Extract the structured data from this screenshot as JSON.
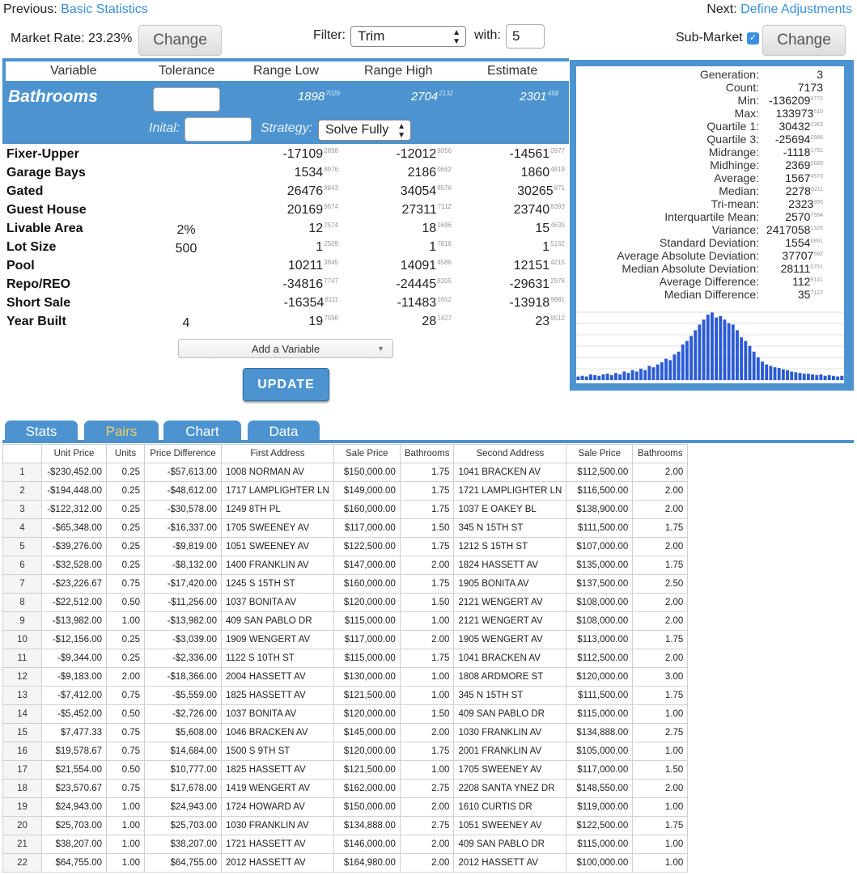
{
  "nav": {
    "previous_label": "Previous:",
    "previous_link": "Basic Statistics",
    "next_label": "Next:",
    "next_link": "Define Adjustments"
  },
  "toolbar": {
    "market_rate": "Market Rate: 23.23%",
    "change_left": "Change",
    "filter_label": "Filter:",
    "filter_value": "Trim",
    "with_label": "with:",
    "with_value": "5",
    "submarket_label": "Sub-Market",
    "submarket_checked": true,
    "change_right": "Change"
  },
  "columns": {
    "variable": "Variable",
    "tolerance": "Tolerance",
    "range_low": "Range Low",
    "range_high": "Range High",
    "estimate": "Estimate"
  },
  "selected": {
    "name": "Bathrooms",
    "low": "1898",
    "low_sup": "7029",
    "high": "2704",
    "high_sup": "2132",
    "est": "2301",
    "est_sup": "458",
    "initial_label": "Inital:",
    "strategy_label": "Strategy:",
    "strategy_value": "Solve Fully"
  },
  "variables": [
    {
      "name": "Fixer-Upper",
      "tol": "",
      "low": "-17109",
      "low_sup": "2898",
      "high": "-12012",
      "high_sup": "9056",
      "est": "-14561",
      "est_sup": "0977"
    },
    {
      "name": "Garage Bays",
      "tol": "",
      "low": "1534",
      "low_sup": "8976",
      "high": "2186",
      "high_sup": "0662",
      "est": "1860",
      "est_sup": "4819"
    },
    {
      "name": "Gated",
      "tol": "",
      "low": "26476",
      "low_sup": "8843",
      "high": "34054",
      "high_sup": "8576",
      "est": "30265",
      "est_sup": "871"
    },
    {
      "name": "Guest House",
      "tol": "",
      "low": "20169",
      "low_sup": "9674",
      "high": "27311",
      "high_sup": "7112",
      "est": "23740",
      "est_sup": "8393"
    },
    {
      "name": "Livable Area",
      "tol": "2%",
      "low": "12",
      "low_sup": "7574",
      "high": "18",
      "high_sup": "1696",
      "est": "15",
      "est_sup": "4635"
    },
    {
      "name": "Lot Size",
      "tol": "500",
      "low": "1",
      "low_sup": "2509",
      "high": "1",
      "high_sup": "7816",
      "est": "1",
      "est_sup": "5162"
    },
    {
      "name": "Pool",
      "tol": "",
      "low": "10211",
      "low_sup": "3845",
      "high": "14091",
      "high_sup": "4586",
      "est": "12151",
      "est_sup": "4215"
    },
    {
      "name": "Repo/REO",
      "tol": "",
      "low": "-34816",
      "low_sup": "7747",
      "high": "-24445",
      "high_sup": "8205",
      "est": "-29631",
      "est_sup": "2976"
    },
    {
      "name": "Short Sale",
      "tol": "",
      "low": "-16354",
      "low_sup": "8111",
      "high": "-11483",
      "high_sup": "1652",
      "est": "-13918",
      "est_sup": "9881"
    },
    {
      "name": "Year Built",
      "tol": "4",
      "low": "19",
      "low_sup": "7598",
      "high": "28",
      "high_sup": "1427",
      "est": "23",
      "est_sup": "9512"
    }
  ],
  "add_variable": "Add a Variable",
  "update_button": "UPDATE",
  "stats": [
    {
      "label": "Generation:",
      "value": "3",
      "sup": ""
    },
    {
      "label": "Count:",
      "value": "7173",
      "sup": ""
    },
    {
      "label": "Min:",
      "value": "-136209",
      "sup": "9772"
    },
    {
      "label": "Max:",
      "value": "133973",
      "sup": "519"
    },
    {
      "label": "Quartile 1:",
      "value": "30432",
      "sup": "2363"
    },
    {
      "label": "Quartile 3:",
      "value": "-25694",
      "sup": "0986"
    },
    {
      "label": "Midrange:",
      "value": "-1118",
      "sup": "1791"
    },
    {
      "label": "Midhinge:",
      "value": "2369",
      "sup": "0689"
    },
    {
      "label": "Average:",
      "value": "1567",
      "sup": "4573"
    },
    {
      "label": "Median:",
      "value": "2278",
      "sup": "8211"
    },
    {
      "label": "Tri-mean:",
      "value": "2323",
      "sup": "995"
    },
    {
      "label": "Interquartile Mean:",
      "value": "2570",
      "sup": "7564"
    },
    {
      "label": "Variance:",
      "value": "2417058",
      "sup": "1326"
    },
    {
      "label": "Standard Deviation:",
      "value": "1554",
      "sup": "6891"
    },
    {
      "label": "Average Absolute Deviation:",
      "value": "37707",
      "sup": "592"
    },
    {
      "label": "Median Absolute Deviation:",
      "value": "28111",
      "sup": "0751"
    },
    {
      "label": "Average Difference:",
      "value": "112",
      "sup": "9141"
    },
    {
      "label": "Median Difference:",
      "value": "35",
      "sup": "7122"
    }
  ],
  "histogram": [
    0.05,
    0.06,
    0.05,
    0.08,
    0.07,
    0.06,
    0.08,
    0.09,
    0.07,
    0.1,
    0.08,
    0.12,
    0.1,
    0.14,
    0.12,
    0.16,
    0.14,
    0.2,
    0.18,
    0.22,
    0.25,
    0.3,
    0.28,
    0.36,
    0.4,
    0.5,
    0.55,
    0.62,
    0.7,
    0.78,
    0.85,
    0.92,
    0.95,
    0.88,
    0.9,
    0.85,
    0.8,
    0.78,
    0.7,
    0.6,
    0.55,
    0.48,
    0.4,
    0.32,
    0.26,
    0.22,
    0.2,
    0.18,
    0.17,
    0.15,
    0.14,
    0.12,
    0.11,
    0.1,
    0.09,
    0.09,
    0.08,
    0.07,
    0.08,
    0.06,
    0.07,
    0.06,
    0.05,
    0.06
  ],
  "tabs": [
    "Stats",
    "Pairs",
    "Chart",
    "Data"
  ],
  "active_tab": 1,
  "table_headers": [
    "",
    "Unit Price",
    "Units",
    "Price Difference",
    "First Address",
    "Sale Price",
    "Bathrooms",
    "Second Address",
    "Sale Price",
    "Bathrooms"
  ],
  "rows": [
    [
      "1",
      "-$230,452.00",
      "0.25",
      "-$57,613.00",
      "1008 NORMAN AV",
      "$150,000.00",
      "1.75",
      "1041 BRACKEN AV",
      "$112,500.00",
      "2.00"
    ],
    [
      "2",
      "-$194,448.00",
      "0.25",
      "-$48,612.00",
      "1717 LAMPLIGHTER LN",
      "$149,000.00",
      "1.75",
      "1721 LAMPLIGHTER LN",
      "$116,500.00",
      "2.00"
    ],
    [
      "3",
      "-$122,312.00",
      "0.25",
      "-$30,578.00",
      "1249 8TH PL",
      "$160,000.00",
      "1.75",
      "1037 E OAKEY BL",
      "$138,900.00",
      "2.00"
    ],
    [
      "4",
      "-$65,348.00",
      "0.25",
      "-$16,337.00",
      "1705 SWEENEY AV",
      "$117,000.00",
      "1.50",
      "345 N 15TH ST",
      "$111,500.00",
      "1.75"
    ],
    [
      "5",
      "-$39,276.00",
      "0.25",
      "-$9,819.00",
      "1051 SWEENEY AV",
      "$122,500.00",
      "1.75",
      "1212 S 15TH ST",
      "$107,000.00",
      "2.00"
    ],
    [
      "6",
      "-$32,528.00",
      "0.25",
      "-$8,132.00",
      "1400 FRANKLIN AV",
      "$147,000.00",
      "2.00",
      "1824 HASSETT AV",
      "$135,000.00",
      "1.75"
    ],
    [
      "7",
      "-$23,226.67",
      "0.75",
      "-$17,420.00",
      "1245 S 15TH ST",
      "$160,000.00",
      "1.75",
      "1905 BONITA AV",
      "$137,500.00",
      "2.50"
    ],
    [
      "8",
      "-$22,512.00",
      "0.50",
      "-$11,256.00",
      "1037 BONITA AV",
      "$120,000.00",
      "1.50",
      "2121 WENGERT AV",
      "$108,000.00",
      "2.00"
    ],
    [
      "9",
      "-$13,982.00",
      "1.00",
      "-$13,982.00",
      "409 SAN PABLO DR",
      "$115,000.00",
      "1.00",
      "2121 WENGERT AV",
      "$108,000.00",
      "2.00"
    ],
    [
      "10",
      "-$12,156.00",
      "0.25",
      "-$3,039.00",
      "1909 WENGERT AV",
      "$117,000.00",
      "2.00",
      "1905 WENGERT AV",
      "$113,000.00",
      "1.75"
    ],
    [
      "11",
      "-$9,344.00",
      "0.25",
      "-$2,336.00",
      "1122 S 10TH ST",
      "$115,000.00",
      "1.75",
      "1041 BRACKEN AV",
      "$112,500.00",
      "2.00"
    ],
    [
      "12",
      "-$9,183.00",
      "2.00",
      "-$18,366.00",
      "2004 HASSETT AV",
      "$130,000.00",
      "1.00",
      "1808 ARDMORE ST",
      "$120,000.00",
      "3.00"
    ],
    [
      "13",
      "-$7,412.00",
      "0.75",
      "-$5,559.00",
      "1825 HASSETT AV",
      "$121,500.00",
      "1.00",
      "345 N 15TH ST",
      "$111,500.00",
      "1.75"
    ],
    [
      "14",
      "-$5,452.00",
      "0.50",
      "-$2,726.00",
      "1037 BONITA AV",
      "$120,000.00",
      "1.50",
      "409 SAN PABLO DR",
      "$115,000.00",
      "1.00"
    ],
    [
      "15",
      "$7,477.33",
      "0.75",
      "$5,608.00",
      "1046 BRACKEN AV",
      "$145,000.00",
      "2.00",
      "1030 FRANKLIN AV",
      "$134,888.00",
      "2.75"
    ],
    [
      "16",
      "$19,578.67",
      "0.75",
      "$14,684.00",
      "1500 S 9TH ST",
      "$120,000.00",
      "1.75",
      "2001 FRANKLIN AV",
      "$105,000.00",
      "1.00"
    ],
    [
      "17",
      "$21,554.00",
      "0.50",
      "$10,777.00",
      "1825 HASSETT AV",
      "$121,500.00",
      "1.00",
      "1705 SWEENEY AV",
      "$117,000.00",
      "1.50"
    ],
    [
      "18",
      "$23,570.67",
      "0.75",
      "$17,678.00",
      "1419 WENGERT AV",
      "$162,000.00",
      "2.75",
      "2208 SANTA YNEZ DR",
      "$148,550.00",
      "2.00"
    ],
    [
      "19",
      "$24,943.00",
      "1.00",
      "$24,943.00",
      "1724 HOWARD AV",
      "$150,000.00",
      "2.00",
      "1610 CURTIS DR",
      "$119,000.00",
      "1.00"
    ],
    [
      "20",
      "$25,703.00",
      "1.00",
      "$25,703.00",
      "1030 FRANKLIN AV",
      "$134,888.00",
      "2.75",
      "1051 SWEENEY AV",
      "$122,500.00",
      "1.75"
    ],
    [
      "21",
      "$38,207.00",
      "1.00",
      "$38,207.00",
      "1721 HASSETT AV",
      "$146,000.00",
      "2.00",
      "409 SAN PABLO DR",
      "$115,000.00",
      "1.00"
    ],
    [
      "22",
      "$64,755.00",
      "1.00",
      "$64,755.00",
      "2012 HASSETT AV",
      "$164,980.00",
      "2.00",
      "2012 HASSETT AV",
      "$100,000.00",
      "1.00"
    ]
  ],
  "colors": {
    "accent": "#4c93d0",
    "active_tab_text": "#f0d060",
    "histogram_bar": "#2a5ad6"
  }
}
